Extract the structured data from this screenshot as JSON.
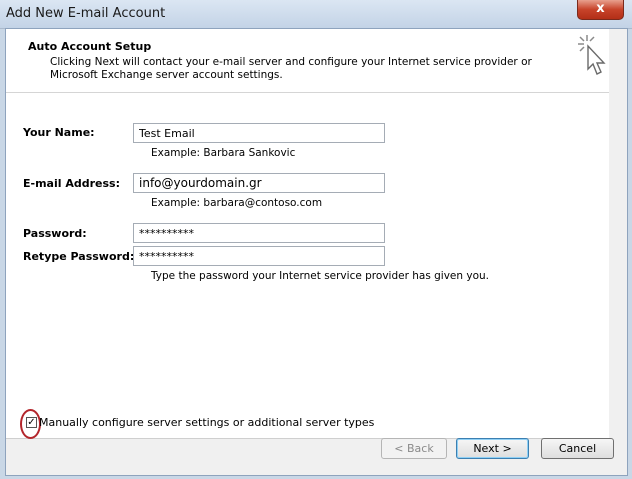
{
  "window": {
    "title": "Add New E-mail Account",
    "close_label": "x"
  },
  "header": {
    "title": "Auto Account Setup",
    "description": "Clicking Next will contact your e-mail server and configure your Internet service provider or Microsoft Exchange server account settings."
  },
  "form": {
    "name_label": "Your Name:",
    "name_value": "Test Email",
    "name_example": "Example: Barbara Sankovic",
    "email_label": "E-mail Address:",
    "email_value": "info@yourdomain.gr",
    "email_example": "Example: barbara@contoso.com",
    "password_label": "Password:",
    "password_value": "**********",
    "retype_label": "Retype Password:",
    "retype_value": "**********",
    "password_hint": "Type the password your Internet service provider has given you."
  },
  "manual_config": {
    "checked": true,
    "check_mark": "✓",
    "label": "Manually configure server settings or additional server types"
  },
  "buttons": {
    "back": "< Back",
    "next": "Next >",
    "cancel": "Cancel"
  },
  "colors": {
    "annotation_circle": "#b3262c",
    "next_focus": "#3c7fb1"
  },
  "icons": {
    "wizard": "cursor-click-sparkle-icon"
  }
}
